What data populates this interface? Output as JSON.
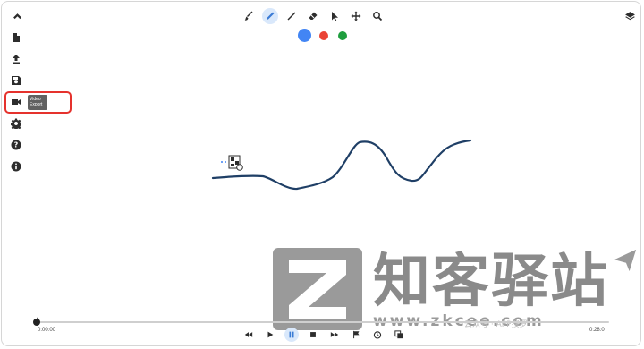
{
  "sidebar": {
    "tooltip": "Video Export"
  },
  "colors": {
    "swatch_blue": "#4285f4",
    "swatch_red": "#ea4335",
    "swatch_green": "#1e9e3e",
    "stroke": "#1f3f66",
    "highlight": "#e5322d",
    "active_bg": "#d9e8fb"
  },
  "toolbar": {
    "tools": [
      "brush-icon",
      "pencil-icon",
      "line-icon",
      "eraser-icon",
      "pointer-icon",
      "move-icon",
      "zoom-icon"
    ],
    "active_tool": "pencil-icon"
  },
  "timeline": {
    "current_time": "0:00:00",
    "end_time": "0:28:0",
    "progress": 0.0,
    "controls": [
      "rewind-icon",
      "play-icon",
      "pause-icon",
      "stop-icon",
      "fast-forward-icon",
      "flag-icon",
      "timer-icon",
      "copy-icon"
    ],
    "active_control": "pause-icon"
  },
  "watermark": {
    "title": "知客驿站",
    "url": "www.zkcee.com",
    "caption": "云众号 · APP搜罗"
  }
}
